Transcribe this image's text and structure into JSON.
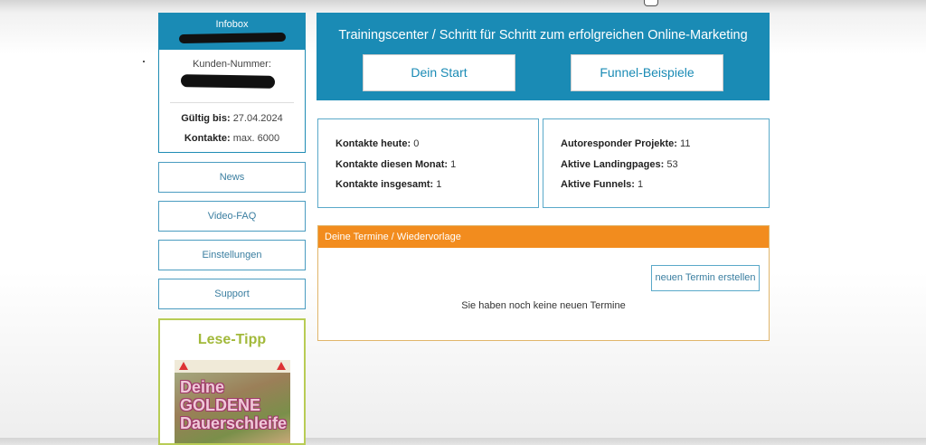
{
  "sidebar": {
    "infobox": {
      "title": "Infobox",
      "kunden_label": "Kunden-Nummer:",
      "gueltig_label": "Gültig bis:",
      "gueltig_value": "27.04.2024",
      "kontakte_label": "Kontakte:",
      "kontakte_value": "max. 6000"
    },
    "nav": {
      "news": "News",
      "video_faq": "Video-FAQ",
      "einstellungen": "Einstellungen",
      "support": "Support"
    },
    "lese_tipp": {
      "title": "Lese-Tipp",
      "book_title_1": "Deine",
      "book_title_2": "GOLDENE",
      "book_title_3": "Dauerschleife"
    }
  },
  "hero": {
    "title": "Trainingscenter / Schritt für Schritt zum erfolgreichen Online-Marketing",
    "start_button": "Dein Start",
    "funnel_button": "Funnel-Beispiele"
  },
  "stats_left": [
    {
      "label": "Kontakte heute:",
      "value": "0"
    },
    {
      "label": "Kontakte diesen Monat:",
      "value": "1"
    },
    {
      "label": "Kontakte insgesamt:",
      "value": "1"
    }
  ],
  "stats_right": [
    {
      "label": "Autoresponder Projekte:",
      "value": "11"
    },
    {
      "label": "Aktive Landingpages:",
      "value": "53"
    },
    {
      "label": "Aktive Funnels:",
      "value": "1"
    }
  ],
  "termine": {
    "title": "Deine Termine / Wiedervorlage",
    "new_button": "neuen Termin erstellen",
    "empty_message": "Sie haben noch keine neuen Termine"
  },
  "colors": {
    "primary": "#1a8bb5",
    "accent_orange": "#f28c1e",
    "lese_green": "#a2b93a"
  }
}
